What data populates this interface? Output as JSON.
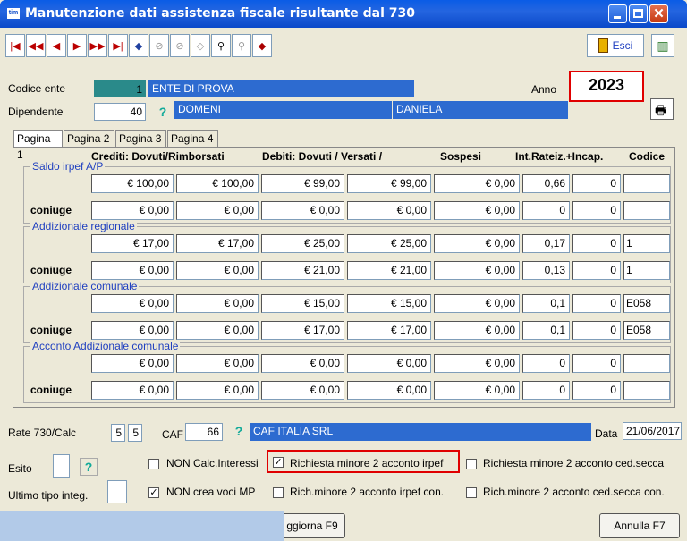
{
  "window": {
    "app_icon": "tim",
    "title": "Manutenzione dati assistenza fiscale risultante dal 730"
  },
  "toolbar": {
    "exit_label": "Esci"
  },
  "header": {
    "codice_ente_label": "Codice ente",
    "codice_ente_value": "1",
    "ente_name": "ENTE DI PROVA",
    "anno_label": "Anno",
    "anno_value": "2023",
    "dipendente_label": "Dipendente",
    "dipendente_value": "40",
    "cognome": "DOMENI",
    "nome": "DANIELA",
    "help_glyph": "?"
  },
  "tabs": [
    "Pagina 1",
    "Pagina 2",
    "Pagina 3",
    "Pagina 4"
  ],
  "columns": {
    "crediti": "Crediti: Dovuti/Rimborsati",
    "debiti": "Debiti: Dovuti  /  Versati  /",
    "sospesi": "Sospesi",
    "int": "Int.Rateiz.+Incap.",
    "codice": "Codice"
  },
  "groups": [
    {
      "title": "Saldo irpef A/P",
      "main": [
        "€ 100,00",
        "€ 100,00",
        "€ 99,00",
        "€ 99,00",
        "€ 0,00",
        "0,66",
        "0",
        ""
      ],
      "spouse_label": "coniuge",
      "spouse": [
        "€ 0,00",
        "€ 0,00",
        "€ 0,00",
        "€ 0,00",
        "€ 0,00",
        "0",
        "0",
        ""
      ]
    },
    {
      "title": "Addizionale regionale",
      "main": [
        "€ 17,00",
        "€ 17,00",
        "€ 25,00",
        "€ 25,00",
        "€ 0,00",
        "0,17",
        "0",
        "1"
      ],
      "spouse_label": "coniuge",
      "spouse": [
        "€ 0,00",
        "€ 0,00",
        "€ 21,00",
        "€ 21,00",
        "€ 0,00",
        "0,13",
        "0",
        "1"
      ]
    },
    {
      "title": "Addizionale comunale",
      "main": [
        "€ 0,00",
        "€ 0,00",
        "€ 15,00",
        "€ 15,00",
        "€ 0,00",
        "0,1",
        "0",
        "E058"
      ],
      "spouse_label": "coniuge",
      "spouse": [
        "€ 0,00",
        "€ 0,00",
        "€ 17,00",
        "€ 17,00",
        "€ 0,00",
        "0,1",
        "0",
        "E058"
      ]
    },
    {
      "title": "Acconto Addizionale comunale",
      "main": [
        "€ 0,00",
        "€ 0,00",
        "€ 0,00",
        "€ 0,00",
        "€ 0,00",
        "0",
        "0",
        ""
      ],
      "spouse_label": "coniuge",
      "spouse": [
        "€ 0,00",
        "€ 0,00",
        "€ 0,00",
        "€ 0,00",
        "€ 0,00",
        "0",
        "0",
        ""
      ]
    }
  ],
  "footer": {
    "rate_label": "Rate 730/Calc",
    "rate1": "5",
    "rate2": "5",
    "caf_label": "CAF",
    "caf_code": "66",
    "caf_name": "CAF ITALIA SRL",
    "data_label": "Data",
    "data_value": "21/06/2017",
    "esito_label": "Esito",
    "ultimo_label": "Ultimo tipo integ.",
    "chk_non_calc": "NON Calc.Interessi",
    "chk_richiesta_irpef": "Richiesta minore 2 acconto irpef",
    "chk_richiesta_ced": "Richiesta minore 2 acconto ced.secca",
    "chk_non_crea": "NON crea voci MP",
    "chk_rich_irpef_con": "Rich.minore 2 acconto irpef con.",
    "chk_rich_ced_con": "Rich.minore 2 acconto ced.secca con.",
    "check_mark": "✓",
    "save_label": "ggiorna F9",
    "cancel_label": "Annulla F7"
  },
  "colors": {
    "highlight_border": "#e00000",
    "field_blue": "#2d6bd0",
    "teal": "#2a8a8a"
  }
}
